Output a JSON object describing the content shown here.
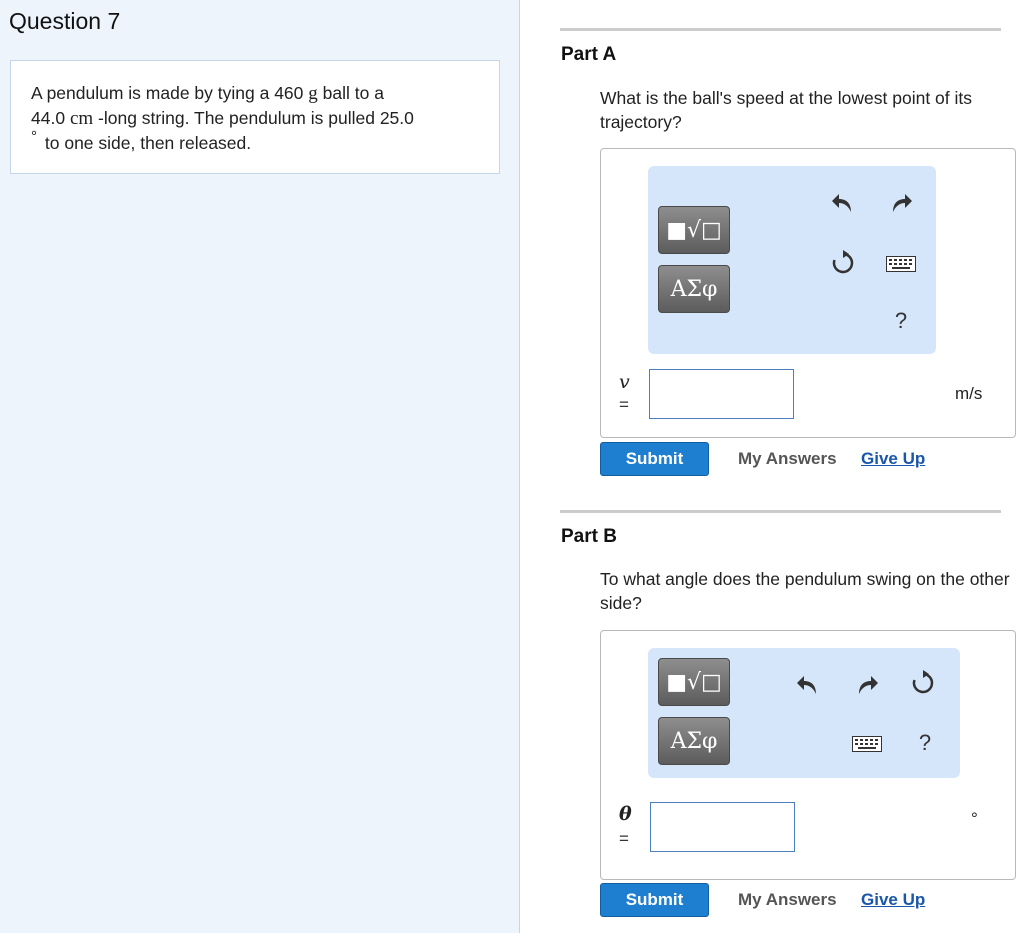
{
  "question": {
    "title": "Question 7",
    "text_1": "A pendulum is made by tying a 460",
    "mass_unit": "g",
    "text_2": "ball to a",
    "length_value": "44.0",
    "length_unit": "cm",
    "text_3": "-long string. The pendulum is pulled 25.0",
    "degree_symbol": "°",
    "text_4": "to one side, then released."
  },
  "part_a": {
    "title": "Part A",
    "question": "What is the ball's speed at the lowest point of its trajectory?",
    "templates_label": "■√□",
    "symbols_label": "ΑΣφ",
    "help_label": "?",
    "variable": "v",
    "equals": "=",
    "input_value": "",
    "unit": "m/s",
    "submit_label": "Submit",
    "my_answers_label": "My Answers",
    "give_up_label": "Give Up"
  },
  "part_b": {
    "title": "Part B",
    "question": "To what angle does the pendulum swing on the other side?",
    "templates_label": "■√□",
    "symbols_label": "ΑΣφ",
    "help_label": "?",
    "variable": "θ",
    "equals": "=",
    "input_value": "",
    "unit": "°",
    "submit_label": "Submit",
    "my_answers_label": "My Answers",
    "give_up_label": "Give Up"
  },
  "colors": {
    "left_panel_bg": "#eef4fb",
    "toolbar_bg": "#d6e6fa",
    "submit_bg": "#1e7fd1",
    "link": "#1a57a8"
  }
}
